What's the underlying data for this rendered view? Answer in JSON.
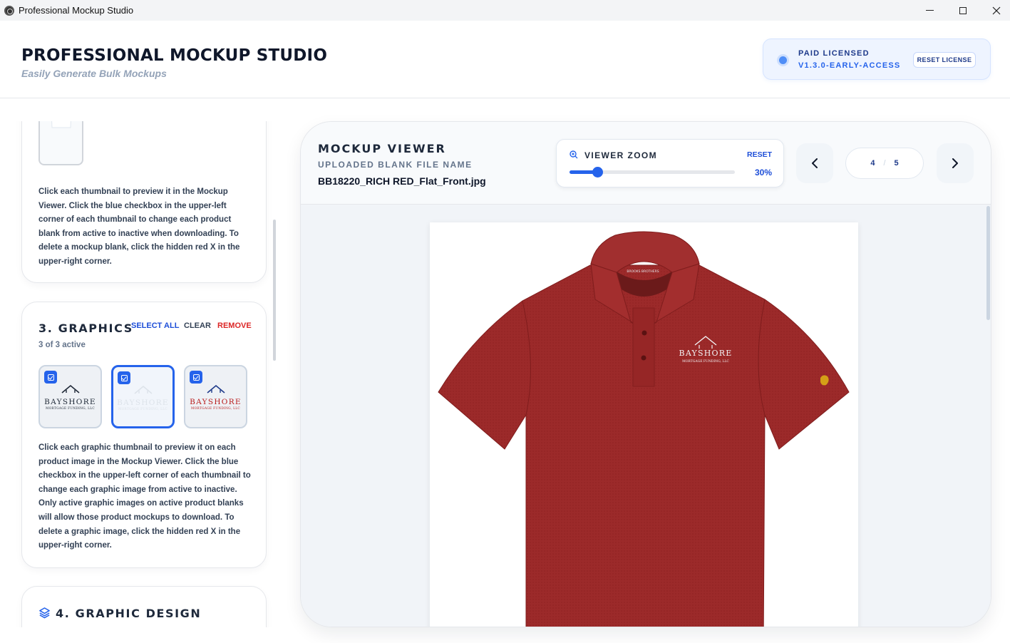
{
  "window": {
    "title": "Professional Mockup Studio"
  },
  "header": {
    "title": "PROFESSIONAL MOCKUP STUDIO",
    "subtitle": "Easily Generate Bulk Mockups",
    "license": {
      "status": "PAID LICENSED",
      "version": "V1.3.0-EARLY-ACCESS",
      "reset_label": "RESET LICENSE"
    }
  },
  "blanks": {
    "help_text": "Click each thumbnail to preview it in the Mockup Viewer. Click the blue checkbox in the upper-left corner of each thumbnail to change each product blank from active to inactive when downloading. To delete a mockup blank, click the hidden red X in the upper-right corner."
  },
  "graphics": {
    "title": "3. GRAPHICS",
    "select_all": "SELECT ALL",
    "clear": "CLEAR",
    "remove": "REMOVE",
    "count": "3 of 3 active",
    "thumbnails": [
      {
        "word": "BAYSHORE",
        "tag": "MORTGAGE FUNDING, LLC",
        "word_color": "#1f2937",
        "roof_color": "#1f2937",
        "selected": false
      },
      {
        "word": "BAYSHORE",
        "tag": "MORTGAGE FUNDING, LLC",
        "word_color": "#dde3ea",
        "roof_color": "#dde3ea",
        "selected": true
      },
      {
        "word": "BAYSHORE",
        "tag": "MORTGAGE FUNDING, LLC",
        "word_color": "#b91c1c",
        "roof_color": "#1e3a8a",
        "selected": false
      }
    ],
    "help_text": "Click each graphic thumbnail to preview it on each product image in the Mockup Viewer. Click the blue checkbox in the upper-left corner of each thumbnail to change each graphic image from active to inactive. Only active graphic images on active product blanks will allow those product mockups to download. To delete a graphic image, click the hidden red X in the upper-right corner."
  },
  "graphic_design": {
    "title": "4. GRAPHIC DESIGN"
  },
  "viewer": {
    "title": "MOCKUP VIEWER",
    "file_label": "UPLOADED BLANK FILE NAME",
    "file_name": "BB18220_RICH RED_Flat_Front.jpg",
    "zoom": {
      "label": "VIEWER ZOOM",
      "reset": "RESET",
      "value_text": "30%",
      "value": 0.3
    },
    "pager": {
      "current": "4",
      "total": "5"
    },
    "mockup": {
      "shirt_color": "#9c2a2a",
      "logo_word": "BAYSHORE",
      "logo_tag": "MORTGAGE FUNDING, LLC"
    }
  },
  "colors": {
    "accent": "#2563eb",
    "danger": "#dc2626",
    "shirt": "#9c2a2a"
  }
}
